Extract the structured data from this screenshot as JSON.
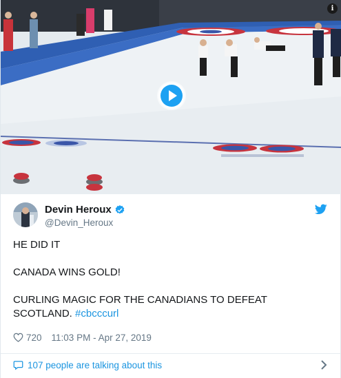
{
  "user": {
    "name": "Devin Heroux",
    "handle": "@Devin_Heroux"
  },
  "tweet": {
    "line1": "HE DID IT",
    "line2": "CANADA WINS GOLD!",
    "line3a": "CURLING MAGIC FOR THE CANADIANS TO DEFEAT",
    "line3b": "SCOTLAND.",
    "hashtag": "#cbcccurl"
  },
  "meta": {
    "likes": "720",
    "timestamp": "11:03 PM - Apr 27, 2019"
  },
  "footer": {
    "talking_label": "107 people are talking about this"
  },
  "icons": {
    "play": "play-icon",
    "info": "info-icon",
    "verified": "verified-badge-icon",
    "twitter": "twitter-bird-icon",
    "heart": "heart-icon",
    "bubble": "speech-bubble-icon",
    "chevron": "chevron-right-icon"
  },
  "colors": {
    "accent": "#1da1f2",
    "link": "#1b95e0",
    "muted": "#657786"
  }
}
